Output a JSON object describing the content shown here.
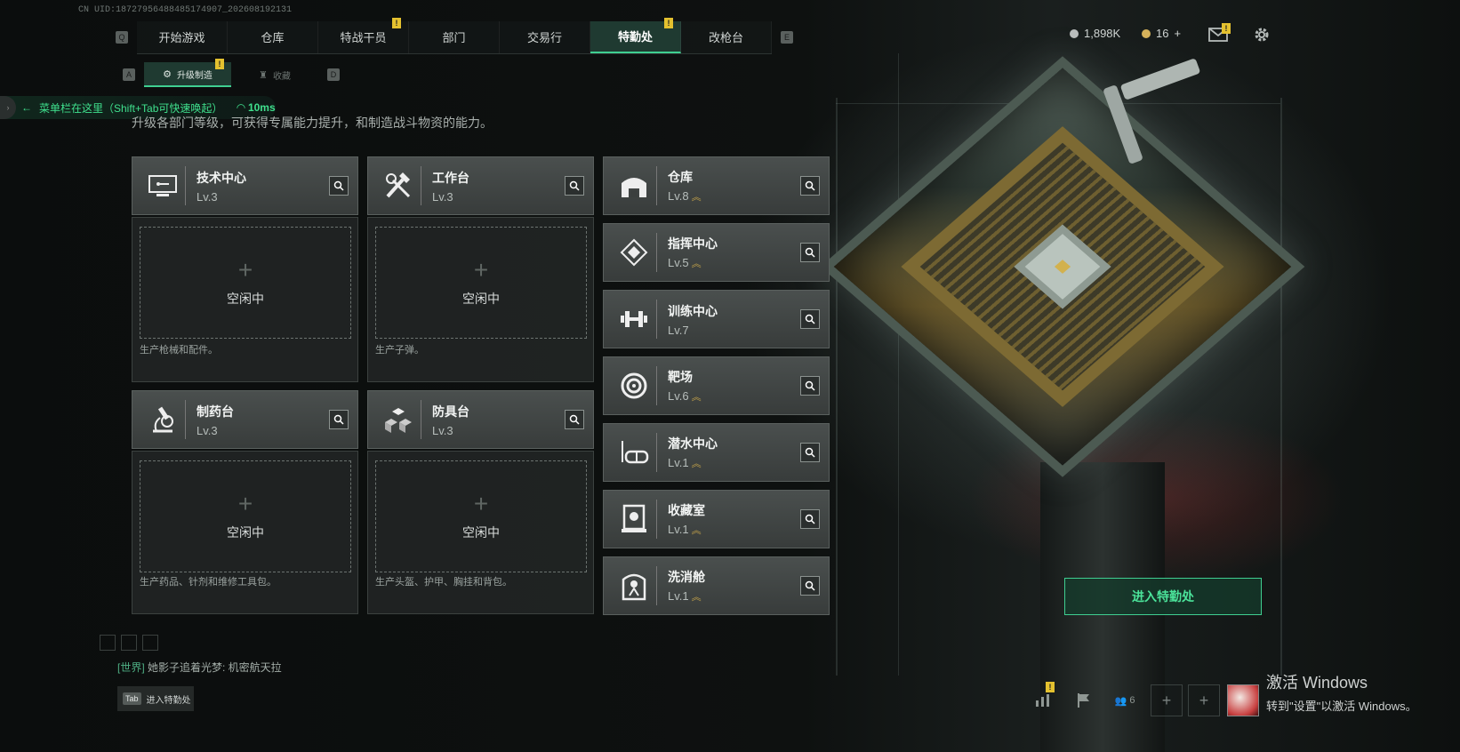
{
  "uid": "CN UID:187279564884851749​07_202608192131",
  "nav": {
    "left_key": "Q",
    "right_key": "E",
    "tabs": [
      {
        "label": "开始游戏",
        "badge": ""
      },
      {
        "label": "仓库",
        "badge": ""
      },
      {
        "label": "特战干员",
        "badge": "!"
      },
      {
        "label": "部门",
        "badge": ""
      },
      {
        "label": "交易行",
        "badge": ""
      },
      {
        "label": "特勤处",
        "badge": "!"
      },
      {
        "label": "改枪台",
        "badge": ""
      }
    ],
    "active": "特勤处"
  },
  "subnav": {
    "left_key": "A",
    "right_key": "D",
    "tabs": [
      {
        "label": "升级制造",
        "badge": "!"
      },
      {
        "label": "收藏",
        "badge": ""
      }
    ]
  },
  "toast": {
    "text": "菜单栏在这里（Shift+Tab可快速唤起）",
    "ping": "10ms"
  },
  "description": "升级各部门等级，可获得专属能力提升，和制造战斗物资的能力。",
  "production": [
    {
      "name": "技术中心",
      "level": "Lv.3",
      "idle": "空闲中",
      "plus": "+",
      "desc": "生产枪械和配件。",
      "icon": "computer-icon"
    },
    {
      "name": "工作台",
      "level": "Lv.3",
      "idle": "空闲中",
      "plus": "+",
      "desc": "生产子弹。",
      "icon": "tools-icon"
    },
    {
      "name": "制药台",
      "level": "Lv.3",
      "idle": "空闲中",
      "plus": "+",
      "desc": "生产药品、针剂和维修工具包。",
      "icon": "microscope-icon"
    },
    {
      "name": "防具台",
      "level": "Lv.3",
      "idle": "空闲中",
      "plus": "+",
      "desc": "生产头盔、护甲、胸挂和背包。",
      "icon": "boxes-icon"
    }
  ],
  "facilities": [
    {
      "name": "仓库",
      "level": "Lv.8",
      "upgrade": "︽",
      "icon": "warehouse-icon"
    },
    {
      "name": "指挥中心",
      "level": "Lv.5",
      "upgrade": "︽",
      "icon": "command-icon"
    },
    {
      "name": "训练中心",
      "level": "Lv.7",
      "upgrade": "",
      "icon": "dumbbell-icon"
    },
    {
      "name": "靶场",
      "level": "Lv.6",
      "upgrade": "︽",
      "icon": "target-icon"
    },
    {
      "name": "潜水中心",
      "level": "Lv.1",
      "upgrade": "︽",
      "icon": "dive-mask-icon"
    },
    {
      "name": "收藏室",
      "level": "Lv.1",
      "upgrade": "︽",
      "icon": "collection-icon"
    },
    {
      "name": "洗消舱",
      "level": "Lv.1",
      "upgrade": "︽",
      "icon": "decon-icon"
    }
  ],
  "enter_button": "进入特勤处",
  "chat": {
    "channel": "[世界]",
    "message": "她影子追着光梦: 机密航天拉"
  },
  "tab_hint": {
    "key": "Tab",
    "label": "进入特勤处"
  },
  "currency": [
    {
      "value": "1,898K",
      "color": "#b9bdbc"
    },
    {
      "value": "16",
      "color": "#d6b25a",
      "add": "+"
    }
  ],
  "bottom_right": {
    "friends": "6"
  },
  "watermark": {
    "line1": "激活 Windows",
    "line2": "转到\"设置\"以激活 Windows。"
  },
  "colors": {
    "accent": "#3fcf91",
    "badge": "#e4c12f",
    "upgrade": "#c9a64a"
  }
}
